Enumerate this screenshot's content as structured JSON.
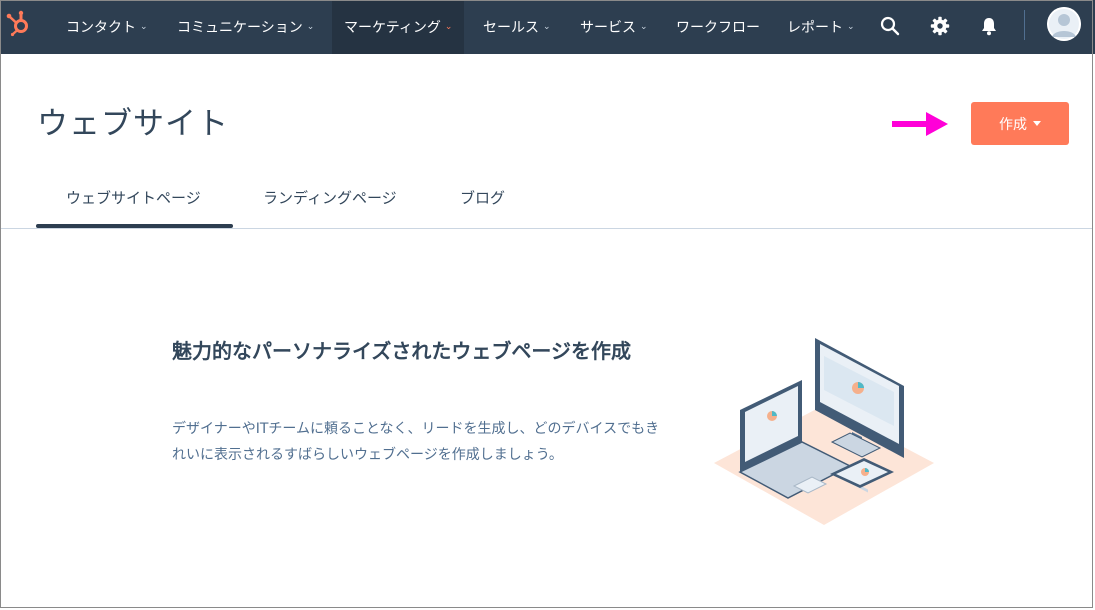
{
  "nav": {
    "items": [
      {
        "label": "コンタクト"
      },
      {
        "label": "コミュニケーション"
      },
      {
        "label": "マーケティング"
      },
      {
        "label": "セールス"
      },
      {
        "label": "サービス"
      },
      {
        "label": "ワークフロー"
      },
      {
        "label": "レポート"
      }
    ],
    "active_item": "マーケティング",
    "icons": [
      "search-icon",
      "gear-icon",
      "bell-icon"
    ]
  },
  "header": {
    "title": "ウェブサイト",
    "create_label": "作成"
  },
  "tabs": [
    {
      "label": "ウェブサイトページ",
      "active": true
    },
    {
      "label": "ランディングページ",
      "active": false
    },
    {
      "label": "ブログ",
      "active": false
    }
  ],
  "empty_state": {
    "heading": "魅力的なパーソナライズされたウェブページを作成",
    "description": "デザイナーやITチームに頼ることなく、リードを生成し、どのデバイスでもきれいに表示されるすばらしいウェブページを作成しましょう。"
  },
  "colors": {
    "nav_bg": "#2d3e50",
    "accent": "#ff7a59",
    "arrow": "#ff00d8",
    "text": "#33475b"
  }
}
